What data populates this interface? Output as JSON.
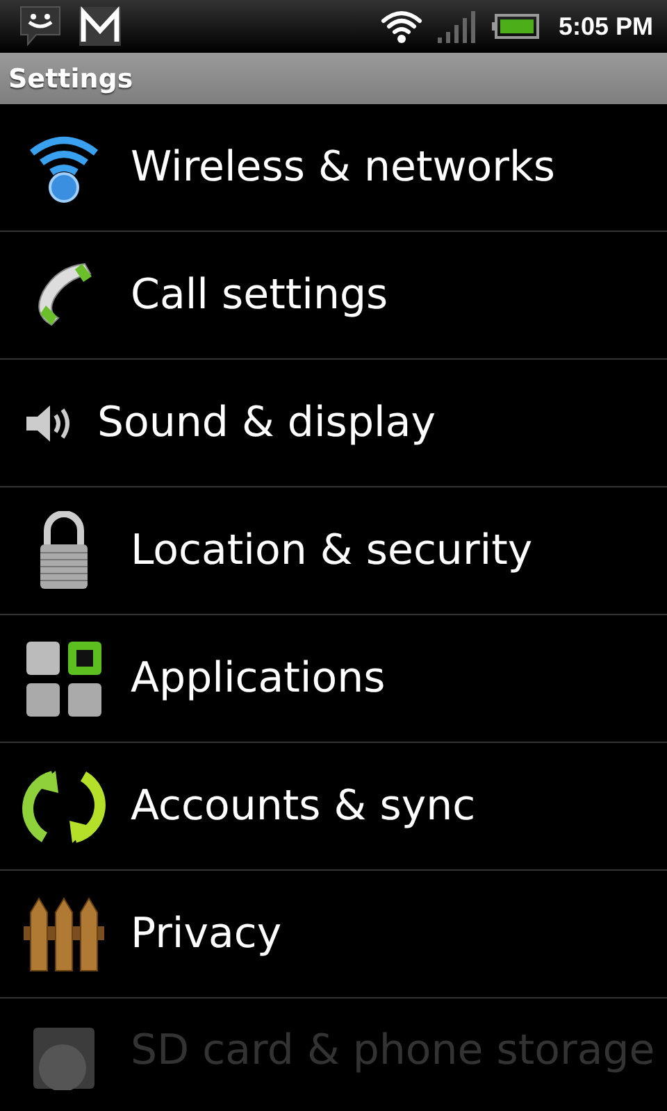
{
  "status_bar": {
    "time": "5:05 PM"
  },
  "title_bar": {
    "title": "Settings"
  },
  "items": [
    {
      "label": "Wireless & networks"
    },
    {
      "label": "Call settings"
    },
    {
      "label": "Sound & display"
    },
    {
      "label": "Location & security"
    },
    {
      "label": "Applications"
    },
    {
      "label": "Accounts & sync"
    },
    {
      "label": "Privacy"
    },
    {
      "label": "SD card & phone storage"
    }
  ]
}
